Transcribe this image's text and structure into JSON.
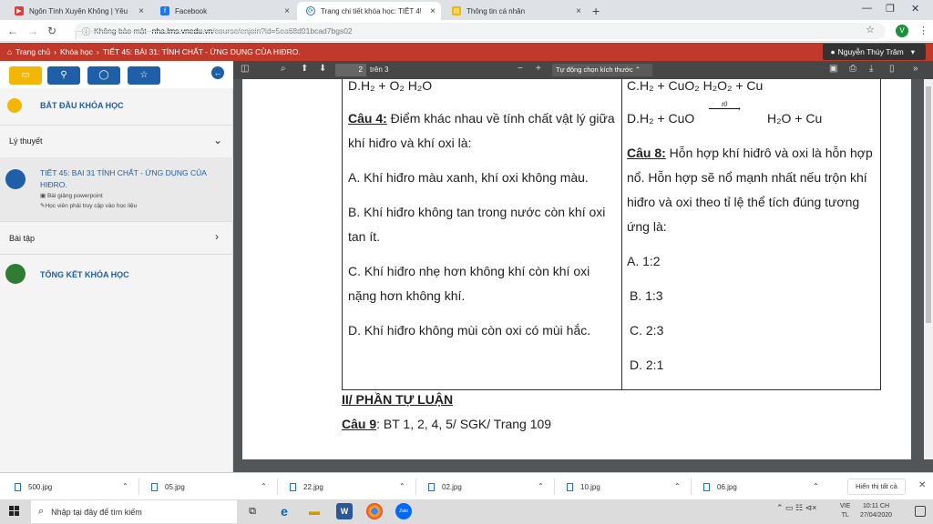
{
  "browser": {
    "tabs": [
      {
        "title": "Ngôn Tình Xuyên Không | Yêu Đ...",
        "icon": "youtube-icon",
        "color": "#e53935",
        "active": false
      },
      {
        "title": "Facebook",
        "icon": "facebook-icon",
        "color": "#1877f2",
        "active": false
      },
      {
        "title": "Trang chi tiết khóa học: TIẾT 45: I...",
        "icon": "vnedu-icon",
        "color": "#1a73e8",
        "active": true
      },
      {
        "title": "Thông tin cá nhân",
        "icon": "page-icon",
        "color": "#f2b705",
        "active": false
      }
    ],
    "new_tab": "+",
    "address": {
      "security": "Không bảo mật",
      "separator": "|",
      "domain": "nha.lms.vnedu.vn",
      "path": "/course/enjoin?id=5ea68d01bcad7bgs02"
    },
    "profile_initial": "V"
  },
  "site": {
    "breadcrumb": [
      "Trang chủ",
      "›",
      "Khóa học",
      "›",
      "TIẾT 45: BÀI 31: TÍNH CHẤT - ỨNG DỤNG CỦA HIĐRO."
    ],
    "user": "Nguyễn Thùy Trâm"
  },
  "sidebar": {
    "start": "BẮT ĐẦU KHÓA HỌC",
    "theory": "Lý thuyết",
    "lesson_title_1": "TIẾT 45: BAI 31 TÍNH CHẤT - ỨNG DỤNG CỦA",
    "lesson_title_2": "HIĐRO.",
    "lesson_note_1": "Bài giảng powerpoint",
    "lesson_note_2": "Học viên phải truy cập vào học liệu",
    "exercises": "Bài tập",
    "summary": "TỔNG KẾT KHÓA HỌC"
  },
  "pdf_toolbar": {
    "page": "2",
    "of": "trên 3",
    "zoom": "Tự động chọn kích thước"
  },
  "document": {
    "top_left": "D.H₂ +   O₂                   H₂O",
    "top_right": "C.H₂ +   CuO₂                  H₂O₂  + Cu",
    "q4_label": "Câu 4:",
    "q4_text_1": " Điểm khác nhau về tính chất vật lý giữa",
    "q4_text_2": "khí hiđro và khí oxi là:",
    "q4_a": "A. Khí hiđro màu xanh, khí oxi không màu.",
    "q4_b1": "B. Khí hiđro không tan trong nước còn khí oxi",
    "q4_b2": "tan ít.",
    "q4_c1": "C. Khí hiđro nhẹ hơn không khí còn khí oxi",
    "q4_c2": "nặng hơn không khí.",
    "q4_d": "D. Khí hiđro không mùi còn oxi có mùi hắc.",
    "q3_d_left": "D.H₂ +   CuO",
    "q3_d_cond": "t0",
    "q3_d_right": "H₂O + Cu",
    "q8_label": "Câu 8:",
    "q8_text_1": " Hỗn hợp khí hiđrô và oxi là hỗn hợp",
    "q8_text_2": "nổ. Hỗn hợp sẽ nổ mạnh nhất nếu trộn khí",
    "q8_text_3": "hiđro và oxi theo tỉ lệ thể tích đúng tương",
    "q8_text_4": "ứng là:",
    "q8_a": "A. 1:2",
    "q8_b": "B. 1:3",
    "q8_c": "C. 2:3",
    "q8_d": "D. 2:1",
    "section2": "II/ PHẦN TỰ LUẬN",
    "q9_label": "Câu 9",
    "q9_text": ":  BT 1, 2, 4, 5/ SGK/ Trang 109"
  },
  "downloads": {
    "files": [
      "500.jpg",
      "05.jpg",
      "22.jpg",
      "02.jpg",
      "10.jpg",
      "06.jpg"
    ],
    "show_all": "Hiển thị tất cả"
  },
  "taskbar": {
    "search_placeholder": "Nhập tại đây để tìm kiếm",
    "lang_1": "VIE",
    "lang_2": "TL",
    "time": "10:11 CH",
    "date": "27/04/2020"
  }
}
